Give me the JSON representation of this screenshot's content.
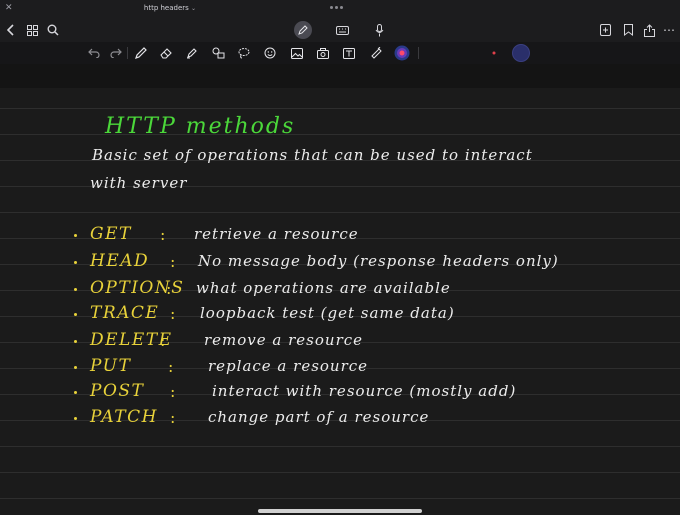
{
  "window": {
    "title": "http headers"
  },
  "note": {
    "title": "HTTP methods",
    "intro_line1": "Basic set of operations that can be used to interact",
    "intro_line2": "with server",
    "methods": [
      {
        "name": "GET",
        "description": "retrieve a resource"
      },
      {
        "name": "HEAD",
        "description": "No message body (response headers only)"
      },
      {
        "name": "OPTIONS",
        "description": "what operations are available"
      },
      {
        "name": "TRACE",
        "description": "loopback test (get same data)"
      },
      {
        "name": "DELETE",
        "description": "remove a resource"
      },
      {
        "name": "PUT",
        "description": "replace a resource"
      },
      {
        "name": "POST",
        "description": "interact with resource (mostly add)"
      },
      {
        "name": "PATCH",
        "description": "change part of a resource"
      }
    ]
  },
  "colors": {
    "title_green": "#4bd83a",
    "method_yellow": "#e8d23a",
    "ink_white": "#ececec",
    "pen_blue": "#4a7bff"
  },
  "icons": {
    "navbar": [
      "chevron-left-icon",
      "grid-icon",
      "search-icon",
      "pen-mode-icon",
      "keyboard-icon",
      "microphone-icon",
      "add-page-icon",
      "bookmark-icon",
      "share-icon",
      "more-icon"
    ],
    "toolbar": [
      "undo-icon",
      "redo-icon",
      "pen-icon",
      "eraser-icon",
      "highlighter-icon",
      "shapes-icon",
      "lasso-icon",
      "sticker-icon",
      "image-icon",
      "camera-icon",
      "text-icon",
      "element-icon",
      "laser-pointer-icon",
      "color-swatch-icon"
    ]
  }
}
